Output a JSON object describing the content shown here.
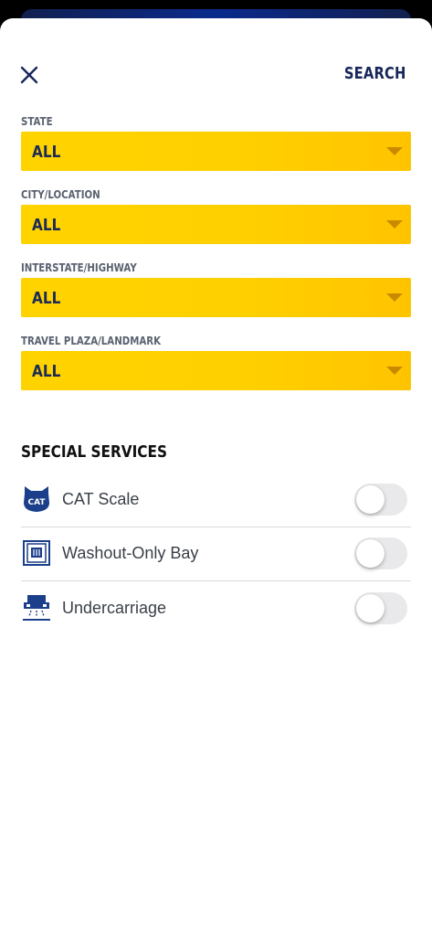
{
  "header": {
    "search_label": "SEARCH"
  },
  "filters": [
    {
      "label": "STATE",
      "value": "ALL"
    },
    {
      "label": "CITY/LOCATION",
      "value": "ALL"
    },
    {
      "label": "INTERSTATE/HIGHWAY",
      "value": "ALL"
    },
    {
      "label": "TRAVEL PLAZA/LANDMARK",
      "value": "ALL"
    }
  ],
  "special_services": {
    "title": "SPECIAL SERVICES",
    "items": [
      {
        "label": "CAT Scale",
        "icon": "cat-scale-icon",
        "enabled": false,
        "icon_text": "CAT"
      },
      {
        "label": "Washout-Only Bay",
        "icon": "washout-bay-icon",
        "enabled": false
      },
      {
        "label": "Undercarriage",
        "icon": "undercarriage-icon",
        "enabled": false
      }
    ]
  },
  "colors": {
    "navy": "#17275a",
    "select_yellow": "#ffd300",
    "caret": "#c98a00",
    "toggle_off": "#e9e9eb"
  }
}
